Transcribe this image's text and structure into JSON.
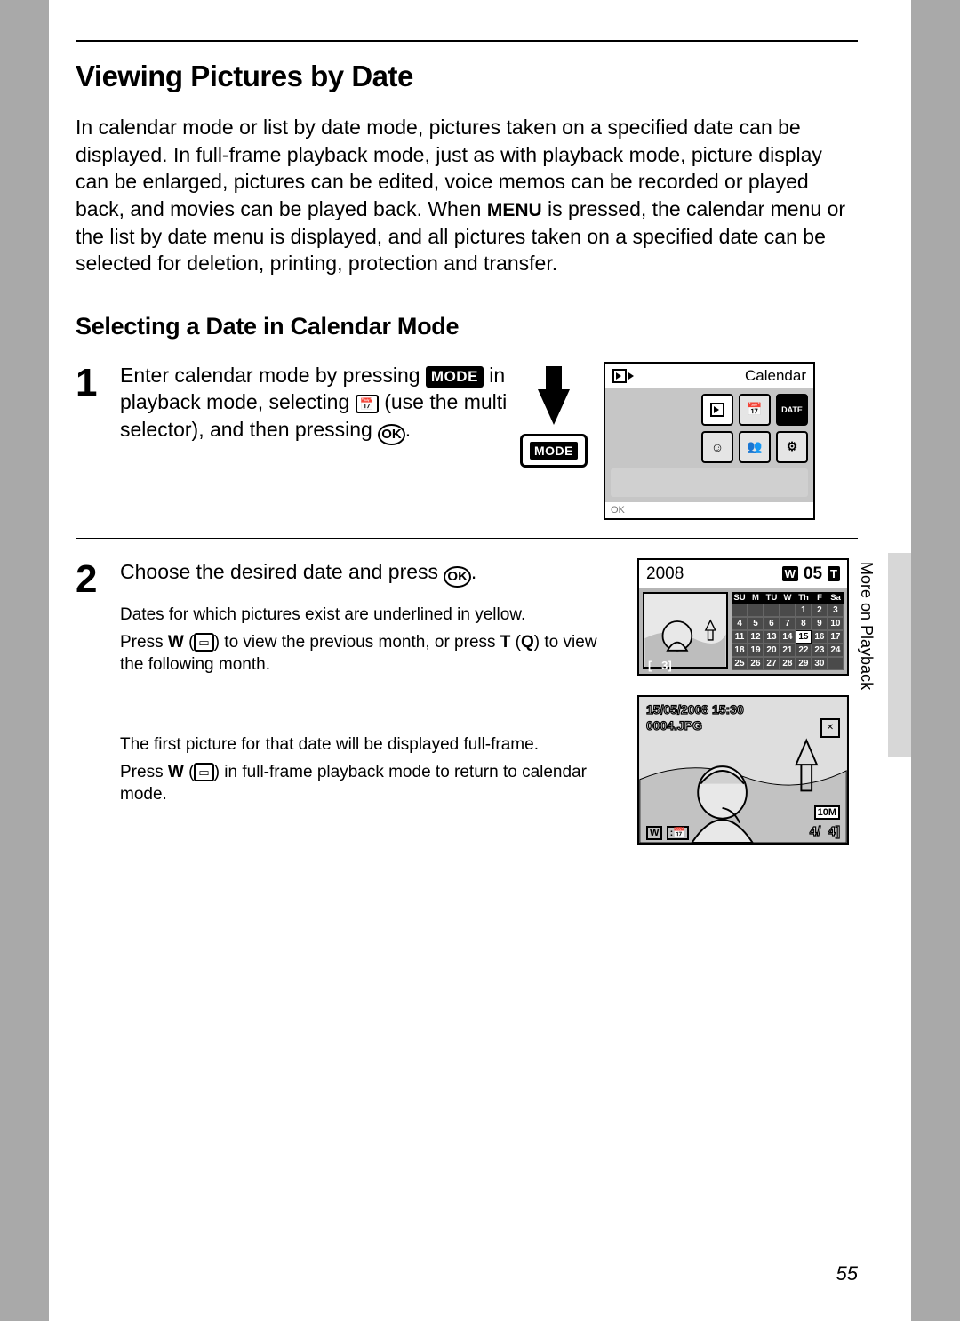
{
  "page": {
    "number": "55",
    "sidebar_label": "More on Playback"
  },
  "title": "Viewing Pictures by Date",
  "intro_a": "In calendar mode or list by date mode, pictures taken on a specified date can be displayed. In full-frame playback mode, just as with playback mode, picture display can be enlarged, pictures can be edited, voice memos can be recorded or played back, and movies can be played back. When ",
  "intro_menu": "MENU",
  "intro_b": " is pressed, the calendar menu or the list by date menu is displayed, and all pictures taken on a specified date can be selected for deletion, printing, protection and transfer.",
  "subtitle": "Selecting a Date in Calendar Mode",
  "step1": {
    "num": "1",
    "a": "Enter calendar mode by pressing ",
    "mode": "MODE",
    "b": " in playback mode, selecting ",
    "c": " (use the multi selector), and then pressing ",
    "ok": "OK",
    "period": ".",
    "mode_label": "MODE",
    "screen_title": "Calendar",
    "icons": {
      "r1": [
        "▶",
        "📅",
        "DATE"
      ],
      "r2": [
        "☺",
        "👥",
        "⚙"
      ]
    }
  },
  "step2": {
    "num": "2",
    "a": "Choose the desired date and press ",
    "ok": "OK",
    "period": ".",
    "note1": "Dates for which pictures exist are underlined in yellow.",
    "note2a": "Press ",
    "W": "W",
    "note2b": " to view the previous month, or press ",
    "T": "T",
    "note2c": " to view the following month.",
    "note3": "The first picture for that date will be displayed full-frame.",
    "note4a": "Press ",
    "note4b": " in full-frame playback mode to return to calendar mode.",
    "calendar": {
      "year": "2008",
      "month": "05",
      "count": "3",
      "dayhead": [
        "SU",
        "M",
        "TU",
        "W",
        "Th",
        "F",
        "Sa"
      ],
      "weeks": [
        [
          "",
          "",
          "",
          "",
          "1",
          "2",
          "3"
        ],
        [
          "4",
          "5",
          "6",
          "7",
          "8",
          "9",
          "10"
        ],
        [
          "11",
          "12",
          "13",
          "14",
          "15",
          "16",
          "17"
        ],
        [
          "18",
          "19",
          "20",
          "21",
          "22",
          "23",
          "24"
        ],
        [
          "25",
          "26",
          "27",
          "28",
          "29",
          "30",
          ""
        ]
      ],
      "selected": "15"
    },
    "playback": {
      "timestamp": "15/05/2008 15:30",
      "filename": "0004.JPG",
      "res": "10M",
      "index": "4",
      "total": "4"
    }
  }
}
